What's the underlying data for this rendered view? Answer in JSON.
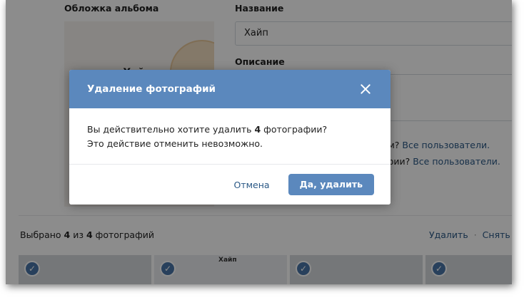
{
  "form": {
    "cover_label": "Обложка альбома",
    "cover_logo": "▪ Хай",
    "title_label": "Название",
    "title_value": "Хайп",
    "description_label": "Описание",
    "privacy_view_prefix": "бом?",
    "privacy_view_link": "Все пользователи.",
    "privacy_comment_prefix": "афии?",
    "privacy_comment_link": "Все пользователи."
  },
  "selection": {
    "text_prefix": "Выбрано ",
    "selected_count": "4",
    "text_middle": " из ",
    "total_count": "4",
    "text_suffix": " фотографий",
    "delete_label": "Удалить",
    "separator": "·",
    "unselect_label": "Снять в"
  },
  "thumbnails": [
    {
      "check": "✓",
      "caption": ""
    },
    {
      "check": "✓",
      "caption": "Хайп"
    },
    {
      "check": "✓",
      "caption": ""
    },
    {
      "check": "✓",
      "caption": ""
    }
  ],
  "modal": {
    "title": "Удаление фотографий",
    "line1_prefix": "Вы действительно хотите удалить ",
    "count": "4",
    "line1_suffix": " фотографии?",
    "line2": "Это действие отменить невозможно.",
    "cancel_label": "Отмена",
    "confirm_label": "Да, удалить"
  },
  "colors": {
    "header": "#5b88bd",
    "link": "#2a5885",
    "check": "#4a76a8"
  }
}
